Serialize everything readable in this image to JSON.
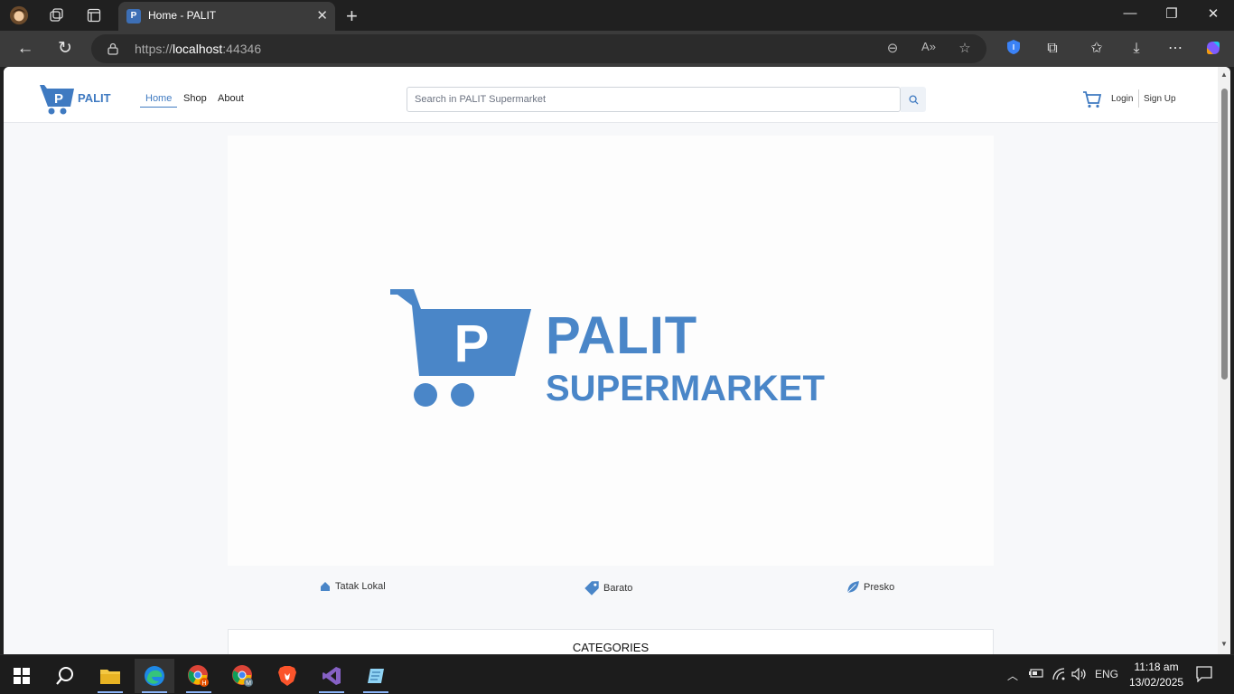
{
  "browser": {
    "tab_title": "Home - PALIT",
    "tab_favicon": "P",
    "url_prefix": "https://",
    "url_host": "localhost",
    "url_port": ":44346"
  },
  "site": {
    "brand": "PALIT",
    "nav": [
      {
        "label": "Home",
        "active": true
      },
      {
        "label": "Shop",
        "active": false
      },
      {
        "label": "About",
        "active": false
      }
    ],
    "search_placeholder": "Search in PALIT Supermarket",
    "login": "Login",
    "signup": "Sign Up"
  },
  "hero": {
    "title": "PALIT",
    "subtitle": "SUPERMARKET",
    "logo_letter": "P",
    "brand_color": "#4a86c8"
  },
  "features": [
    {
      "icon": "home-icon",
      "label": "Tatak Lokal"
    },
    {
      "icon": "tag-icon",
      "label": "Barato"
    },
    {
      "icon": "leaf-icon",
      "label": "Presko"
    }
  ],
  "categories_title": "CATEGORIES",
  "taskbar": {
    "language": "ENG",
    "time": "11:18 am",
    "date": "13/02/2025"
  }
}
